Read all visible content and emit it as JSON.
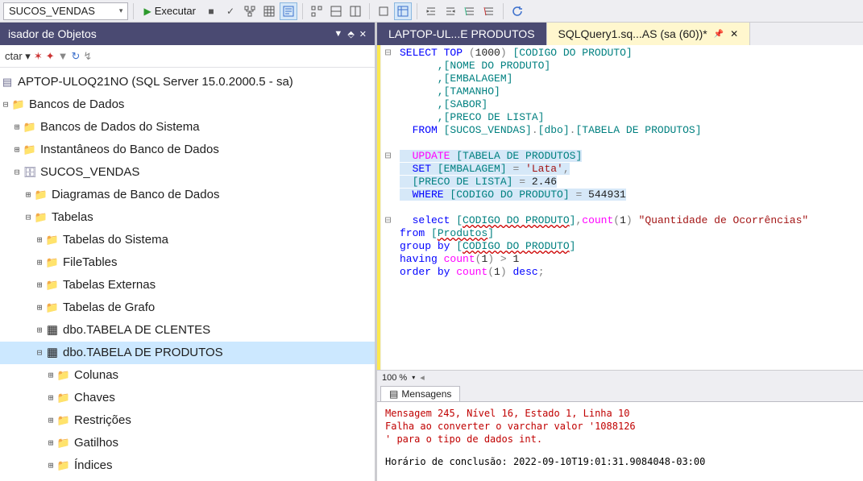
{
  "toolbar": {
    "database": "SUCOS_VENDAS",
    "execute": "Executar"
  },
  "sidebar": {
    "title": "isador de Objetos",
    "connect_label": "ctar ▾",
    "server": "APTOP-ULOQ21NO (SQL Server 15.0.2000.5 - sa)",
    "nodes": {
      "bancos": "Bancos de Dados",
      "bancos_sistema": "Bancos de Dados do Sistema",
      "instantaneos": "Instantâneos do Banco de Dados",
      "sucos": "SUCOS_VENDAS",
      "diagramas": "Diagramas de Banco de Dados",
      "tabelas": "Tabelas",
      "tab_sistema": "Tabelas do Sistema",
      "filetables": "FileTables",
      "tab_externas": "Tabelas Externas",
      "tab_grafo": "Tabelas de Grafo",
      "clientes": "dbo.TABELA DE CLENTES",
      "produtos": "dbo.TABELA DE PRODUTOS",
      "colunas": "Colunas",
      "chaves": "Chaves",
      "restricoes": "Restrições",
      "gatilhos": "Gatilhos",
      "indices": "Índices"
    }
  },
  "tabs": {
    "inactive": "LAPTOP-UL...E PRODUTOS",
    "active": "SQLQuery1.sq...AS (sa (60))*"
  },
  "code": {
    "l1a": "SELECT",
    "l1b": " TOP ",
    "l1c": "(",
    "l1d": "1000",
    "l1e": ")",
    "l1f": " [CODIGO DO PRODUTO]",
    "l2": "      ,[NOME DO PRODUTO]",
    "l3": "      ,[EMBALAGEM]",
    "l4": "      ,[TAMANHO]",
    "l5": "      ,[SABOR]",
    "l6": "      ,[PRECO DE LISTA]",
    "l7a": "  FROM",
    "l7b": " [SUCOS_VENDAS]",
    "l7c": ".",
    "l7d": "[dbo]",
    "l7e": ".",
    "l7f": "[TABELA DE PRODUTOS]",
    "l9a": "  UPDATE",
    "l9b": " [TABELA DE PRODUTOS]",
    "l10a": "  SET",
    "l10b": " [EMBALAGEM] ",
    "l10c": "=",
    "l10d": " 'Lata'",
    "l10e": ",",
    "l11a": "  [PRECO DE LISTA] ",
    "l11b": "=",
    "l11c": " 2.46",
    "l12a": "  WHERE",
    "l12b": " [CODIGO DO PRODUTO] ",
    "l12c": "=",
    "l12d": " 544931",
    "l14a": "  select",
    "l14b": " [",
    "l14c": "CODIGO DO PRODUTO",
    "l14d": "]",
    "l14e": ",",
    "l14f": "count",
    "l14g": "(",
    "l14h": "1",
    "l14i": ")",
    "l14j": " \"Quantidade de Ocorrências\"",
    "l15a": "from",
    "l15b": " [",
    "l15c": "Produtos",
    "l15d": "]",
    "l16a": "group",
    "l16b": " by",
    "l16c": " [",
    "l16d": "CODIGO DO PRODUTO",
    "l16e": "]",
    "l17a": "having",
    "l17b": " count",
    "l17c": "(",
    "l17d": "1",
    "l17e": ")",
    "l17f": " >",
    "l17g": " 1",
    "l18a": "order",
    "l18b": " by",
    "l18c": " count",
    "l18d": "(",
    "l18e": "1",
    "l18f": ")",
    "l18g": " desc",
    "l18h": ";"
  },
  "zoom": "100 %",
  "msg_tab": "Mensagens",
  "messages": {
    "l1": "Mensagem 245, Nível 16, Estado 1, Linha 10",
    "l2": "Falha ao converter o varchar valor '1088126",
    "l3": "' para o tipo de dados int.",
    "l4": "Horário de conclusão: 2022-09-10T19:01:31.9084048-03:00"
  }
}
